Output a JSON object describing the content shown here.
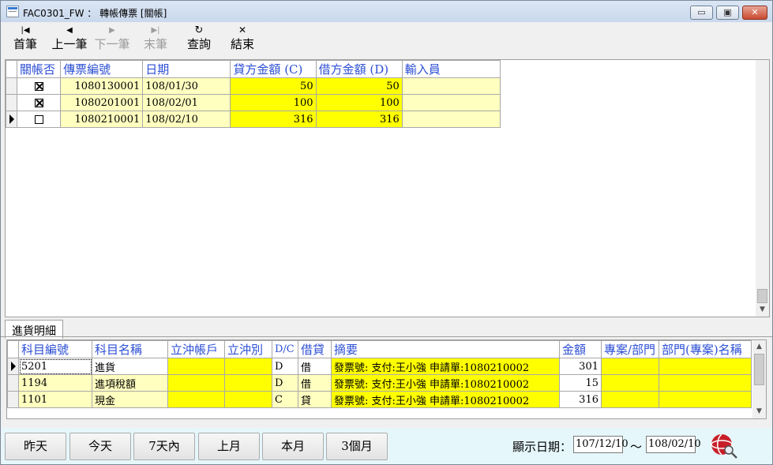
{
  "window": {
    "title": "FAC0301_FW ： 轉帳傳票 [關帳]",
    "minimize": "▭",
    "maximize": "▣",
    "close": "✕"
  },
  "toolbar": {
    "first": {
      "label": "首筆",
      "icon": "|◀"
    },
    "prev": {
      "label": "上一筆",
      "icon": "◀"
    },
    "next": {
      "label": "下一筆",
      "icon": "▶"
    },
    "last": {
      "label": "末筆",
      "icon": "▶|"
    },
    "query": {
      "label": "查詢",
      "icon": "↻"
    },
    "exit": {
      "label": "結束",
      "icon": "✕"
    }
  },
  "voucher_grid": {
    "headers": [
      "關帳否",
      "傳票編號",
      "日期",
      "貸方金額 (C)",
      "借方金額 (D)",
      "輸入員"
    ],
    "rows": [
      {
        "closed": true,
        "voucher_no": "1080130001",
        "date": "108/01/30",
        "credit": "50",
        "debit": "50",
        "operator": "",
        "current": false
      },
      {
        "closed": true,
        "voucher_no": "1080201001",
        "date": "108/02/01",
        "credit": "100",
        "debit": "100",
        "operator": "",
        "current": false
      },
      {
        "closed": false,
        "voucher_no": "1080210001",
        "date": "108/02/10",
        "credit": "316",
        "debit": "316",
        "operator": "",
        "current": true
      }
    ]
  },
  "tabs": {
    "detail": "進貨明細"
  },
  "detail_grid": {
    "headers": [
      "科目編號",
      "科目名稱",
      "立沖帳戶",
      "立沖別",
      "D/C",
      "借貸",
      "摘要",
      "金額",
      "專案/部門",
      "部門(專案)名稱"
    ],
    "rows": [
      {
        "code": "5201",
        "name": "進貨",
        "account": "",
        "type": "",
        "dc": "D",
        "side": "借",
        "memo": "發票號: 支付:王小強 申請單:1080210002",
        "amount": "301",
        "project": "",
        "project_name": ""
      },
      {
        "code": "1194",
        "name": "進項稅額",
        "account": "",
        "type": "",
        "dc": "D",
        "side": "借",
        "memo": "發票號: 支付:王小強 申請單:1080210002",
        "amount": "15",
        "project": "",
        "project_name": ""
      },
      {
        "code": "1101",
        "name": "現金",
        "account": "",
        "type": "",
        "dc": "C",
        "side": "貸",
        "memo": "發票號: 支付:王小強 申請單:1080210002",
        "amount": "316",
        "project": "",
        "project_name": ""
      }
    ]
  },
  "footer": {
    "buttons": [
      "昨天",
      "今天",
      "7天內",
      "上月",
      "本月",
      "3個月"
    ],
    "date_label": "顯示日期：",
    "date_from": "107/12/10",
    "tilde": "～",
    "date_to": "108/02/10"
  }
}
